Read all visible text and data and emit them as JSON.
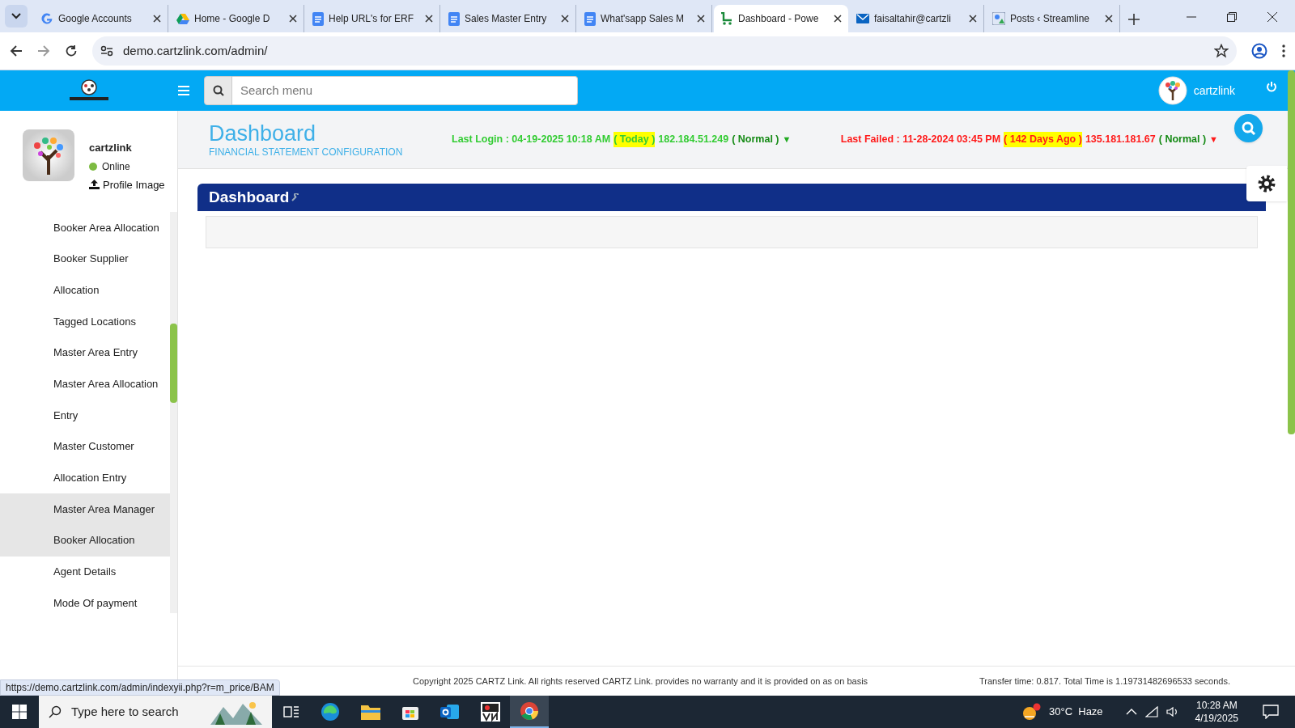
{
  "browser": {
    "tabs": [
      {
        "title": "Google Accounts",
        "kind": "letter",
        "selected": false
      },
      {
        "title": "Home - Google D",
        "kind": "triangle",
        "selected": false
      },
      {
        "title": "Help URL's for ERF",
        "kind": "doc",
        "selected": false
      },
      {
        "title": "Sales Master Entry",
        "kind": "doc",
        "selected": false
      },
      {
        "title": "What'sapp Sales M",
        "kind": "doc",
        "selected": false
      },
      {
        "title": "Dashboard - Powe",
        "kind": "cart",
        "selected": true
      },
      {
        "title": "faisaltahir@cartzli",
        "kind": "mail",
        "selected": false
      },
      {
        "title": "Posts ‹ Streamline",
        "kind": "site",
        "selected": false
      }
    ],
    "url": "demo.cartzlink.com/admin/"
  },
  "header": {
    "search": {
      "placeholder": "Search menu"
    },
    "user": "cartzlink"
  },
  "profile": {
    "name": "cartzlink",
    "status": "Online",
    "upload": "Profile Image"
  },
  "sidebar": {
    "items": [
      {
        "label": "Booker Area Allocation",
        "selected": false
      },
      {
        "label": "Booker Supplier",
        "selected": false
      },
      {
        "label": "Allocation",
        "selected": false
      },
      {
        "label": "Tagged Locations",
        "selected": false
      },
      {
        "label": "Master Area Entry",
        "selected": false
      },
      {
        "label": "Master Area Allocation",
        "selected": false
      },
      {
        "label": "Entry",
        "selected": false
      },
      {
        "label": "Master Customer",
        "selected": false
      },
      {
        "label": "Allocation Entry",
        "selected": false
      },
      {
        "label": "Master Area Manager",
        "selected": true
      },
      {
        "label": "Booker Allocation",
        "selected": true
      },
      {
        "label": "Agent Details",
        "selected": false
      },
      {
        "label": "Mode Of payment",
        "selected": false
      }
    ]
  },
  "page": {
    "title": "Dashboard",
    "subtitle": "FINANCIAL STATEMENT CONFIGURATION",
    "logins": [
      {
        "kind": "success",
        "label": "Last Login : 04-19-2025 10:18 AM",
        "ago": "( Today )",
        "ip": "182.184.51.249",
        "status": "( Normal )",
        "arrow": "▼"
      },
      {
        "kind": "failure",
        "label": "Last Failed : 11-28-2024 03:45 PM",
        "ago": "( 142 Days Ago )",
        "ip": "135.181.181.67",
        "status": "( Normal )",
        "arrow": "▼"
      }
    ],
    "panel_title": "Dashboard"
  },
  "footer": {
    "copyright": "Copyright 2025 CARTZ Link. All rights reserved CARTZ Link. provides no warranty and it is provided on as on basis",
    "timing": "Transfer time: 0.817. Total Time is 1.19731482696533 seconds."
  },
  "status_url": "https://demo.cartzlink.com/admin/indexyii.php?r=m_price/BAM",
  "taskbar": {
    "search": {
      "placeholder": "Type here to search"
    },
    "weather": "30°C  Haze",
    "time": "10:28 AM",
    "date": "4/19/2025"
  }
}
